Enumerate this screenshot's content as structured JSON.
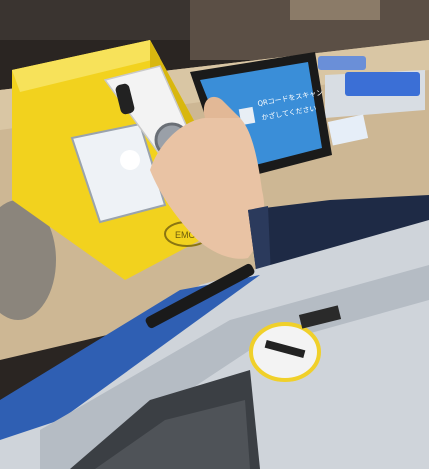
{
  "photo": {
    "alt": "Hand holding a smartphone over a yellow NFC reader next to a tablet showing a QR code on a station ticket gate"
  },
  "reader": {
    "brand_logo": "EMO"
  },
  "tablet_screen": {
    "line1": "QRコードをスキャン",
    "line2": "かざしてください"
  },
  "colors": {
    "reader_yellow": "#f2d21e",
    "gate_blue": "#2f5fb3",
    "counter_tan": "#cdb794",
    "sleeve_navy": "#1e2a45",
    "tablet_screen_blue": "#3a8ed8",
    "slot_ring_yellow": "#f0d02a"
  }
}
